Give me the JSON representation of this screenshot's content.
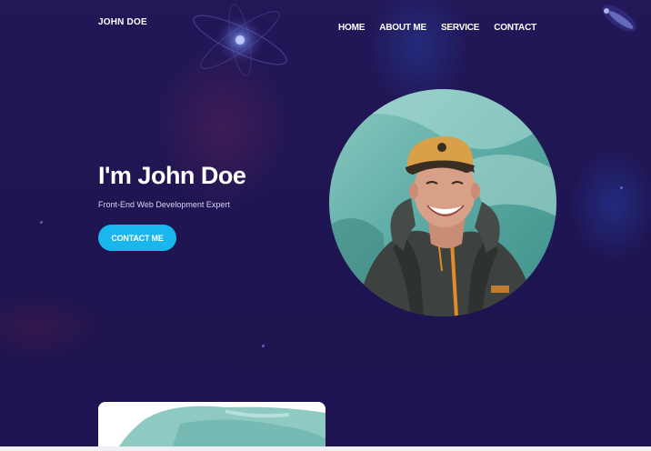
{
  "header": {
    "brand": "JOHN DOE",
    "nav": [
      {
        "label": "HOME"
      },
      {
        "label": "ABOUT ME"
      },
      {
        "label": "SERVICE"
      },
      {
        "label": "CONTACT"
      }
    ]
  },
  "hero": {
    "title": "I'm John Doe",
    "subtitle": "Front-End Web Development Expert",
    "cta_label": "CONTACT ME"
  },
  "colors": {
    "background": "#1e1452",
    "accent": "#1ab7ee",
    "text": "#ffffff",
    "jacket_zipper": "#e08a2a"
  },
  "icons": [
    "atom-planet-decoration",
    "comet-decoration"
  ]
}
